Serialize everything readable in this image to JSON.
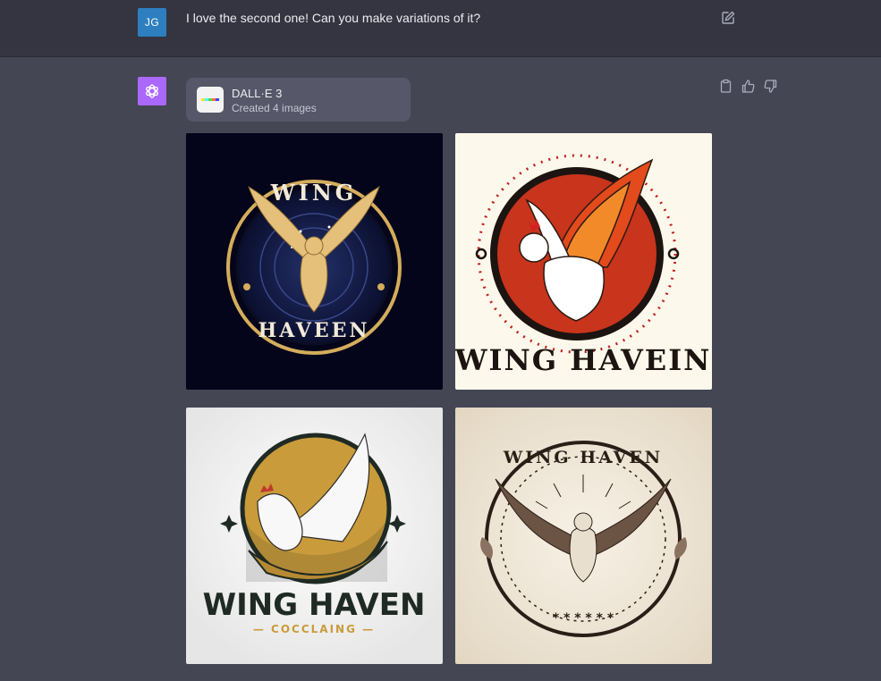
{
  "user": {
    "initials": "JG",
    "message": "I love the second one! Can you make variations of it?"
  },
  "assistant": {
    "tool": {
      "name": "DALL·E 3",
      "status": "Created 4 images"
    }
  },
  "images": [
    {
      "top": "WING",
      "bottom": "HAVEEN",
      "style": "navy-gold"
    },
    {
      "top": "",
      "bottom": "WING HAVEIN",
      "style": "flame-red"
    },
    {
      "top": "",
      "bottom": "WING HAVEN",
      "sub": "— COCCLAING —",
      "style": "gold-white"
    },
    {
      "top": "WING HAVEN",
      "bottom": "",
      "stars": "* * * * * *",
      "style": "vintage-sepia"
    }
  ],
  "colors": {
    "user_bg": "#343541",
    "assistant_bg": "#444654",
    "user_avatar": "#2d7fbf",
    "gpt_avatar": "#ab68ff",
    "tool_card": "#565869"
  },
  "icons": [
    "edit-icon",
    "openai-logo-icon",
    "clipboard-icon",
    "thumbs-up-icon",
    "thumbs-down-icon"
  ]
}
